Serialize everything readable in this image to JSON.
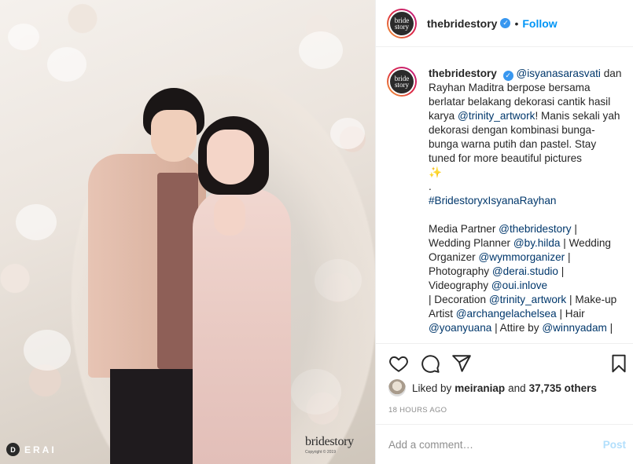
{
  "photo": {
    "watermark_left": "ERAI",
    "watermark_left_mark": "D",
    "watermark_brand": "bridestory",
    "watermark_copyright": "Copyright © 2019"
  },
  "header": {
    "avatar_text_top": "bride",
    "avatar_text_bottom": "story",
    "username": "thebridestory",
    "verified_glyph": "✓",
    "separator": "•",
    "follow_label": "Follow"
  },
  "caption": {
    "username": "thebridestory",
    "mention_1": "@isyanasarasvati",
    "text_1": " dan Rayhan Maditra berpose bersama berlatar belakang dekorasi cantik hasil karya ",
    "mention_2": "@trinity_artwork",
    "text_2": "! Manis sekali yah dekorasi dengan kombinasi bunga-bunga warna putih dan pastel. Stay tuned for more beautiful pictures",
    "emoji": "✨",
    "dot_line": ".",
    "hashtag": "#BridestoryxIsyanaRayhan",
    "credits": [
      {
        "label": "Media Partner ",
        "handle": "@thebridestory",
        "sep": " | "
      },
      {
        "label": "Wedding Planner ",
        "handle": "@by.hilda",
        "sep": " | "
      },
      {
        "label": "Wedding Organizer ",
        "handle": "@wymmorganizer",
        "sep": " | "
      },
      {
        "label": "Photography  ",
        "handle": "@derai.studio",
        "sep": " | "
      },
      {
        "label": "Videography ",
        "handle": "@oui.inlove",
        "sep": ""
      },
      {
        "label": "| Decoration ",
        "handle": "@trinity_artwork",
        "sep": " | "
      },
      {
        "label": "Make-up Artist ",
        "handle": "@archangelachelsea",
        "sep": " | "
      },
      {
        "label": "Hair ",
        "handle": "@yoanyuana",
        "sep": " | "
      },
      {
        "label": "Attire by ",
        "handle": "@winnyadam",
        "sep": " |"
      }
    ]
  },
  "actions": {
    "like_icon": "heart-icon",
    "comment_icon": "comment-icon",
    "share_icon": "paper-plane-icon",
    "save_icon": "bookmark-icon"
  },
  "likes": {
    "prefix": "Liked by ",
    "user": "meiraniap",
    "middle": " and ",
    "count": "37,735 others"
  },
  "timestamp": "18 HOURS AGO",
  "comment": {
    "placeholder": "Add a comment…",
    "post_label": "Post"
  },
  "colors": {
    "link": "#00376b",
    "follow": "#0095f6",
    "verified": "#3897f0",
    "post_disabled": "#b2dffc"
  }
}
